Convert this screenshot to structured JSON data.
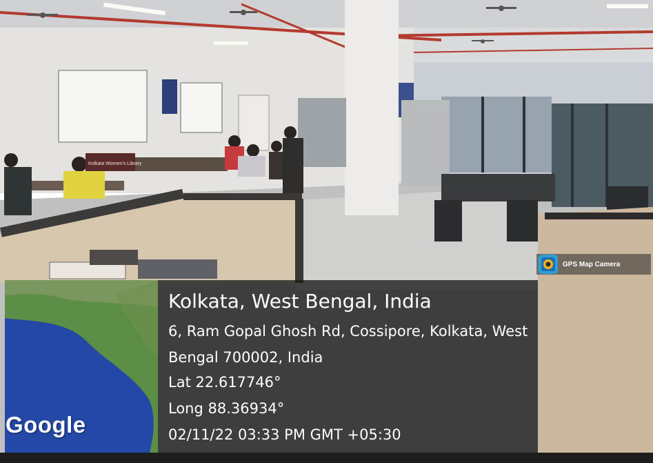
{
  "badge": {
    "label": "GPS Map Camera",
    "icon": "camera-map-icon",
    "colors": {
      "icon_frame": "#2f9fd6",
      "icon_center": "#f3b322"
    }
  },
  "minimap": {
    "provider_logo": "Google",
    "colors": {
      "ocean": "#2448a6",
      "land": "#5c8f45"
    }
  },
  "location": {
    "title": "Kolkata, West Bengal, India",
    "address_line1": "6, Ram Gopal Ghosh Rd, Cossipore, Kolkata, West",
    "address_line2": "Bengal 700002, India",
    "latitude": "Lat 22.617746°",
    "longitude": "Long 88.36934°",
    "datetime": "02/11/22 03:33 PM GMT +05:30"
  },
  "scene": {
    "sign_text": "Kolkata Women's Library",
    "icons": [
      "ceiling-fan-icon",
      "tube-light-icon",
      "notice-board-icon"
    ]
  }
}
